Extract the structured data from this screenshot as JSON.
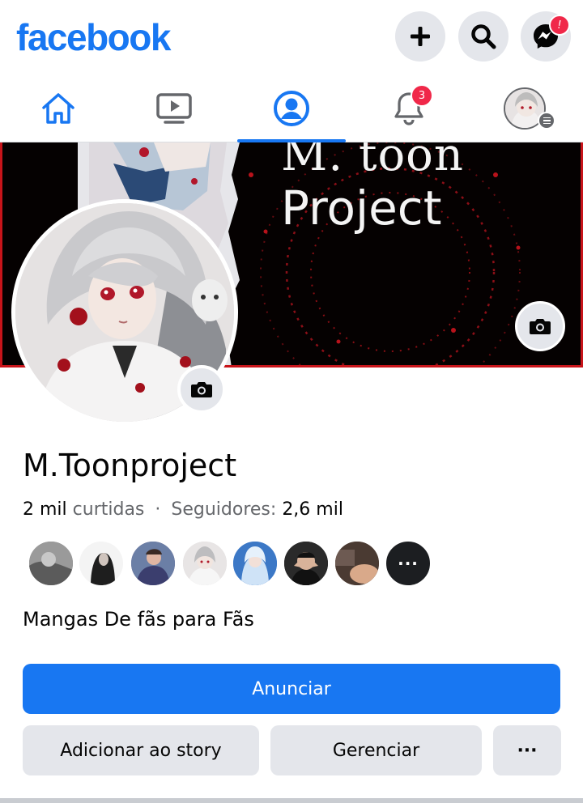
{
  "header": {
    "logo": "facebook",
    "create_icon": "plus-icon",
    "search_icon": "search-icon",
    "messenger_icon": "messenger-icon",
    "messenger_badge": "!"
  },
  "tabs": [
    {
      "name": "home",
      "icon": "home-icon",
      "active": false
    },
    {
      "name": "watch",
      "icon": "video-icon",
      "active": false
    },
    {
      "name": "profile",
      "icon": "profile-icon",
      "active": true
    },
    {
      "name": "notifications",
      "icon": "bell-icon",
      "badge": "3",
      "active": false
    },
    {
      "name": "menu",
      "icon": "avatar-menu-icon",
      "active": false
    }
  ],
  "cover": {
    "title_line1": "M. toon",
    "title_line2": "Project"
  },
  "profile": {
    "name": "M.Toonproject",
    "likes_value": "2 mil",
    "likes_label": "curtidas",
    "separator": "·",
    "followers_label": "Seguidores:",
    "followers_value": "2,6 mil",
    "bio": "Mangas De fãs para Fãs"
  },
  "buttons": {
    "advertise": "Anunciar",
    "add_story": "Adicionar ao story",
    "manage": "Gerenciar",
    "more": "···"
  },
  "colors": {
    "brand": "#1877f2",
    "badge": "#f02849",
    "secondary_bg": "#e4e6eb"
  }
}
